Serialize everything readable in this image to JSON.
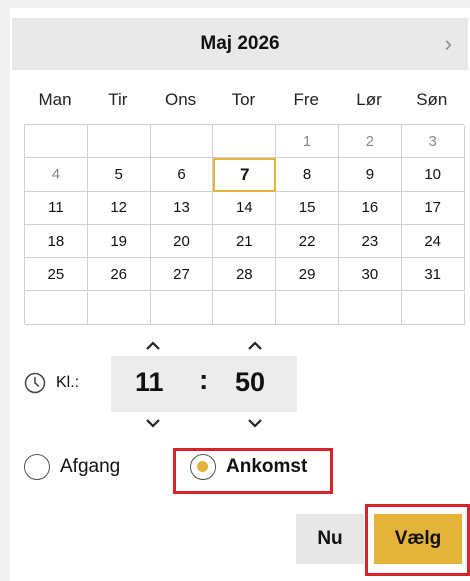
{
  "header": {
    "month_title": "Maj 2026",
    "next_label": "›"
  },
  "weekdays": [
    "Man",
    "Tir",
    "Ons",
    "Tor",
    "Fre",
    "Lør",
    "Søn"
  ],
  "calendar": {
    "rows": [
      [
        "",
        "",
        "",
        "",
        "1",
        "2",
        "3"
      ],
      [
        "4",
        "5",
        "6",
        "7",
        "8",
        "9",
        "10"
      ],
      [
        "11",
        "12",
        "13",
        "14",
        "15",
        "16",
        "17"
      ],
      [
        "18",
        "19",
        "20",
        "21",
        "22",
        "23",
        "24"
      ],
      [
        "25",
        "26",
        "27",
        "28",
        "29",
        "30",
        "31"
      ],
      [
        "",
        "",
        "",
        "",
        "",
        "",
        ""
      ]
    ],
    "muted": [
      "1",
      "2",
      "3",
      "4"
    ],
    "selected_day": "7"
  },
  "time": {
    "label": "Kl.:",
    "hours": "11",
    "separator": ":",
    "minutes": "50"
  },
  "direction": {
    "departure_label": "Afgang",
    "arrival_label": "Ankomst",
    "selected": "arrival"
  },
  "buttons": {
    "now_label": "Nu",
    "choose_label": "Vælg"
  },
  "colors": {
    "accent": "#e4b33a",
    "highlight": "#d8232a",
    "header_bg": "#e9e9e9"
  }
}
